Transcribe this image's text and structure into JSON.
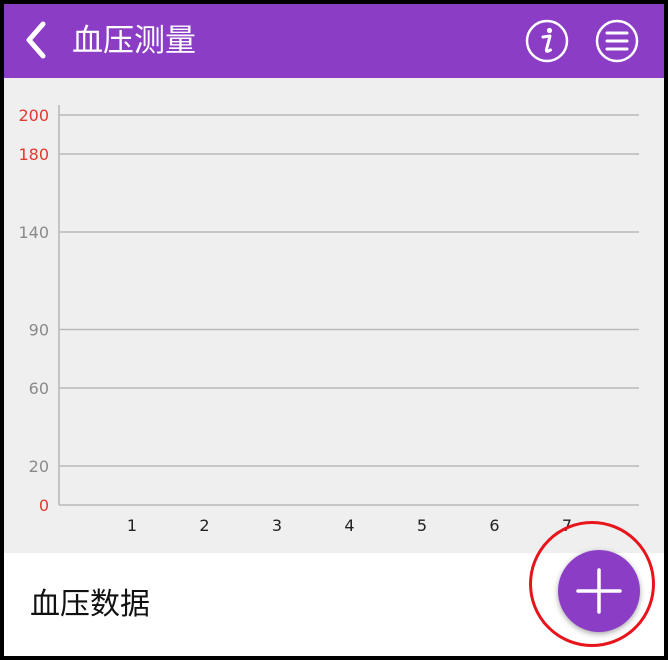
{
  "header": {
    "title": "血压测量",
    "back_icon": "chevron-left-icon",
    "info_icon": "info-icon",
    "menu_icon": "menu-icon",
    "background_color": "#8b3dc5"
  },
  "chart_data": {
    "type": "line",
    "title": "",
    "xlabel": "",
    "ylabel": "",
    "x": [
      1,
      2,
      3,
      4,
      5,
      6,
      7
    ],
    "series": [],
    "y_ticks": [
      {
        "value": 0,
        "label": "0",
        "color": "#e03a2e"
      },
      {
        "value": 20,
        "label": "20",
        "color": "#8a8a8a"
      },
      {
        "value": 60,
        "label": "60",
        "color": "#8a8a8a"
      },
      {
        "value": 90,
        "label": "90",
        "color": "#8a8a8a"
      },
      {
        "value": 140,
        "label": "140",
        "color": "#8a8a8a"
      },
      {
        "value": 180,
        "label": "180",
        "color": "#e03a2e"
      },
      {
        "value": 200,
        "label": "200",
        "color": "#e03a2e"
      }
    ],
    "grid": true,
    "legend": "none"
  },
  "data_section": {
    "title": "血压数据"
  },
  "fab": {
    "icon": "plus-icon",
    "color": "#8b3dc5",
    "highlight_color": "#e8141c"
  }
}
